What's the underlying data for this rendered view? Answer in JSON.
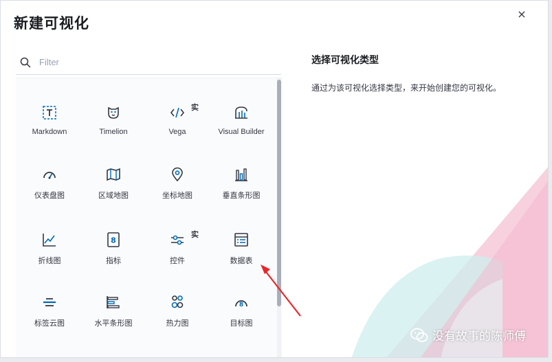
{
  "modal": {
    "title": "新建可视化",
    "close_symbol": "×"
  },
  "search": {
    "placeholder": "Filter",
    "value": ""
  },
  "description": {
    "title": "选择可视化类型",
    "text": "通过为该可视化选择类型，来开始创建您的可视化。"
  },
  "types": [
    {
      "label": "Markdown",
      "icon": "markdown-icon",
      "badge": ""
    },
    {
      "label": "Timelion",
      "icon": "timelion-icon",
      "badge": ""
    },
    {
      "label": "Vega",
      "icon": "code-icon",
      "badge": "实"
    },
    {
      "label": "Visual Builder",
      "icon": "visual-builder-icon",
      "badge": ""
    },
    {
      "label": "仪表盘图",
      "icon": "gauge-icon",
      "badge": ""
    },
    {
      "label": "区域地图",
      "icon": "region-map-icon",
      "badge": ""
    },
    {
      "label": "坐标地图",
      "icon": "map-pin-icon",
      "badge": ""
    },
    {
      "label": "垂直条形图",
      "icon": "vertical-bar-icon",
      "badge": ""
    },
    {
      "label": "折线图",
      "icon": "line-chart-icon",
      "badge": ""
    },
    {
      "label": "指标",
      "icon": "metric-icon",
      "badge": ""
    },
    {
      "label": "控件",
      "icon": "controls-icon",
      "badge": "实"
    },
    {
      "label": "数据表",
      "icon": "data-table-icon",
      "badge": ""
    },
    {
      "label": "标签云图",
      "icon": "tag-cloud-icon",
      "badge": ""
    },
    {
      "label": "水平条形图",
      "icon": "horizontal-bar-icon",
      "badge": ""
    },
    {
      "label": "热力图",
      "icon": "heatmap-icon",
      "badge": ""
    },
    {
      "label": "目标图",
      "icon": "goal-icon",
      "badge": ""
    }
  ],
  "watermark": {
    "text": "没有故事的陈师傅",
    "icon": "wechat-icon"
  },
  "colors": {
    "accent_pink": "#f6c9d8",
    "accent_teal": "#cdeeed",
    "arrow_red": "#e8262a"
  }
}
